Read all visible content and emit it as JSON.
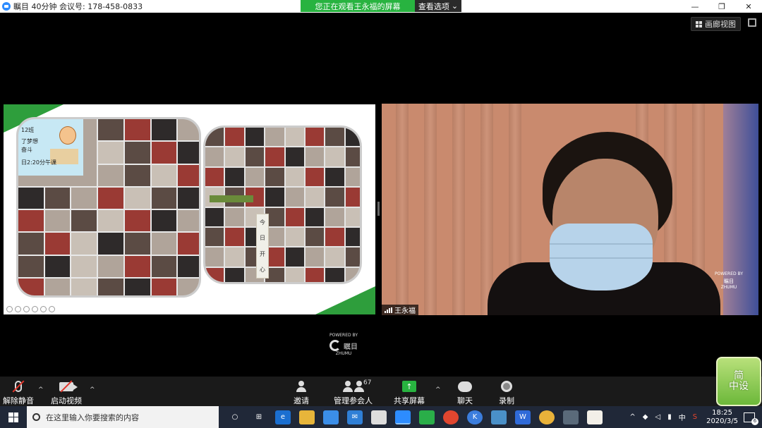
{
  "titlebar": {
    "title": "瞩目 40分钟 会议号: 178-458-0833",
    "minimize": "—",
    "restore": "❐",
    "close": "✕"
  },
  "share": {
    "banner_text": "您正在观看王永福的屏幕",
    "view_options": "查看选项",
    "view_options_caret": "⌄"
  },
  "gallery_view": {
    "label": "画廊视图"
  },
  "slide": {
    "class_label": "12班",
    "dream_line": "了梦想",
    "fight_line": "奋斗",
    "time_line": "日2:20分午课",
    "vertical_chars": [
      "今",
      "日",
      "开",
      "心"
    ]
  },
  "video": {
    "name": "王永福",
    "powered_by": "POWERED BY",
    "brand": "瞩目",
    "brand_en": "ZHUMU"
  },
  "center_powered": {
    "powered_by": "POWERED BY",
    "brand": "瞩目",
    "brand_en": "ZHUMU"
  },
  "controls": {
    "unmute": "解除静音",
    "start_video": "启动视频",
    "invite": "邀请",
    "manage_participants": "管理参会人",
    "participant_count": "67",
    "share_screen": "共享屏幕",
    "chat": "聊天",
    "record": "录制",
    "caret": "^"
  },
  "corner_logo": {
    "line1": "简",
    "line2": "中设"
  },
  "taskbar": {
    "search_placeholder": "在这里输入你要搜索的内容",
    "ime": "中",
    "time": "18:25",
    "date": "2020/3/5",
    "notification_count": "6"
  },
  "colors": {
    "share_green": "#28b340",
    "zoom_blue": "#2d8cff",
    "taskbar": "#202838"
  }
}
